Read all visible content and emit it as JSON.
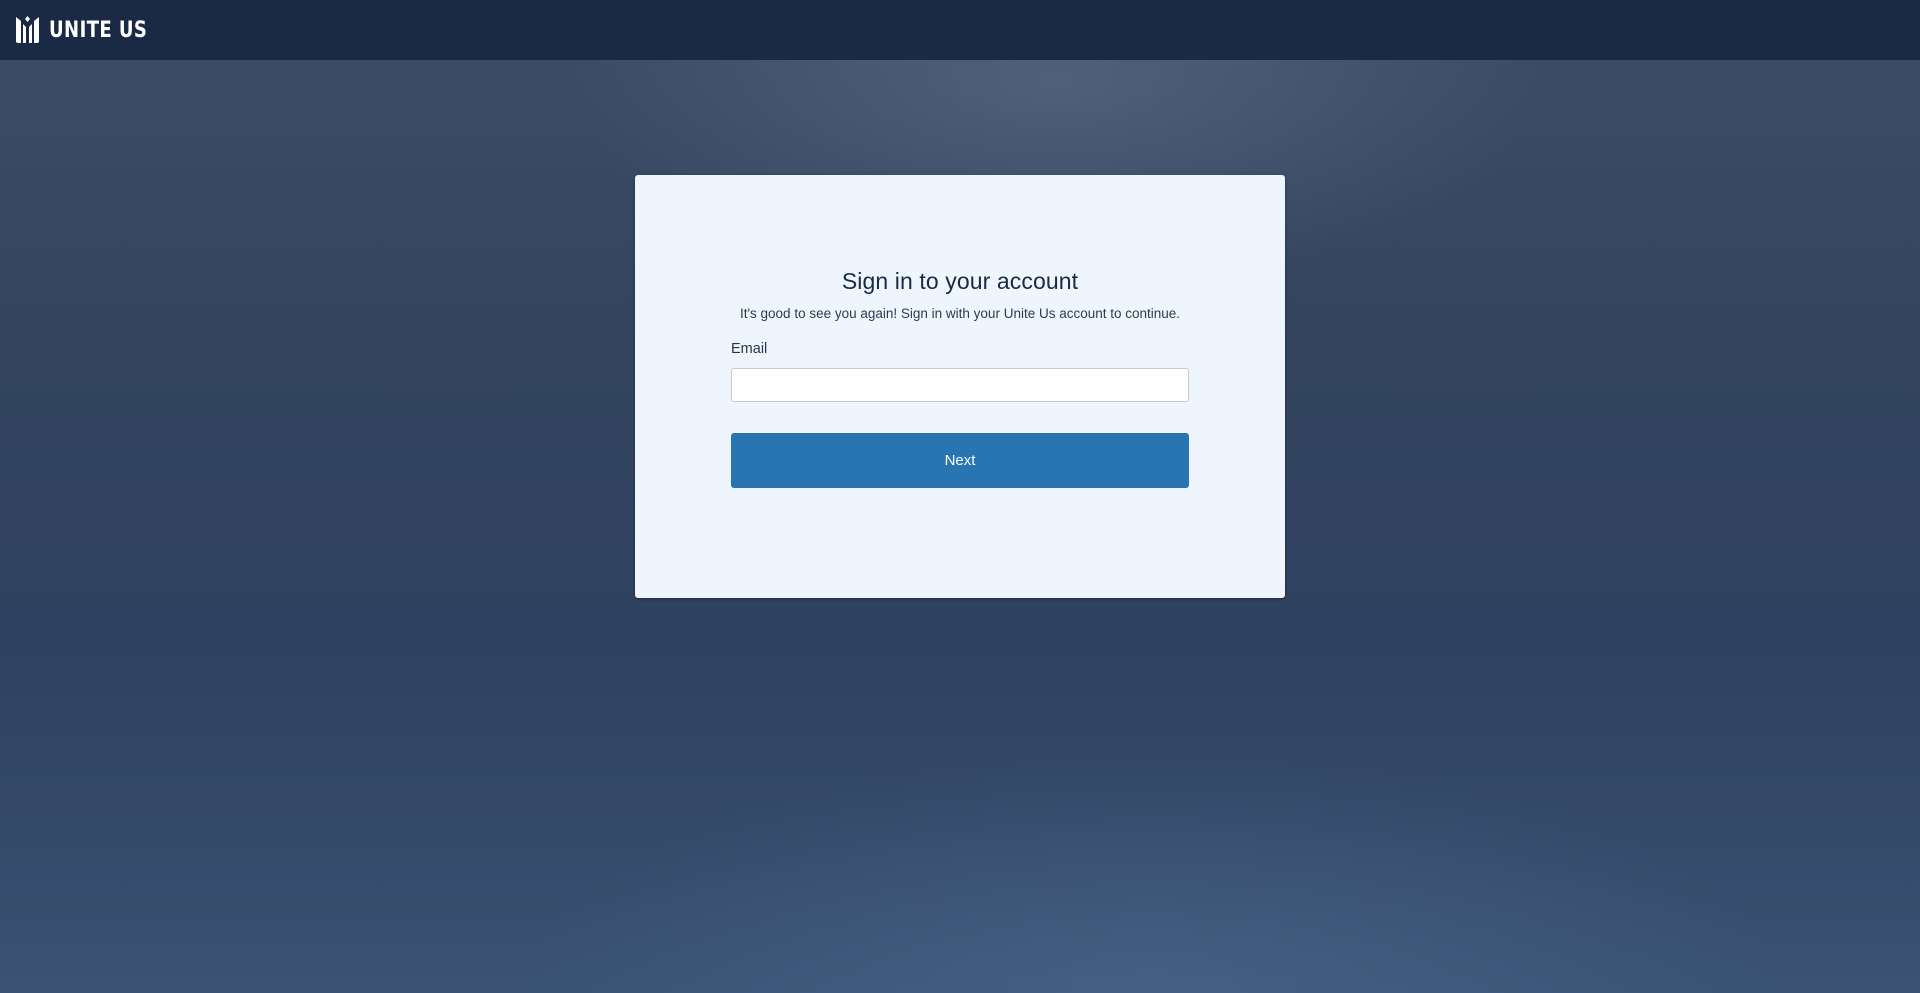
{
  "header": {
    "brand_name": "UNITE US",
    "logo_icon": "unite-us-logo-icon"
  },
  "signin": {
    "title": "Sign in to your account",
    "subtitle": "It's good to see you again! Sign in with your Unite Us account to continue.",
    "email_label": "Email",
    "email_value": "",
    "email_placeholder": "",
    "next_label": "Next"
  },
  "colors": {
    "topbar": "#1a2a45",
    "card": "#eef5fd",
    "button": "#2875b2",
    "title_text": "#182a44"
  }
}
